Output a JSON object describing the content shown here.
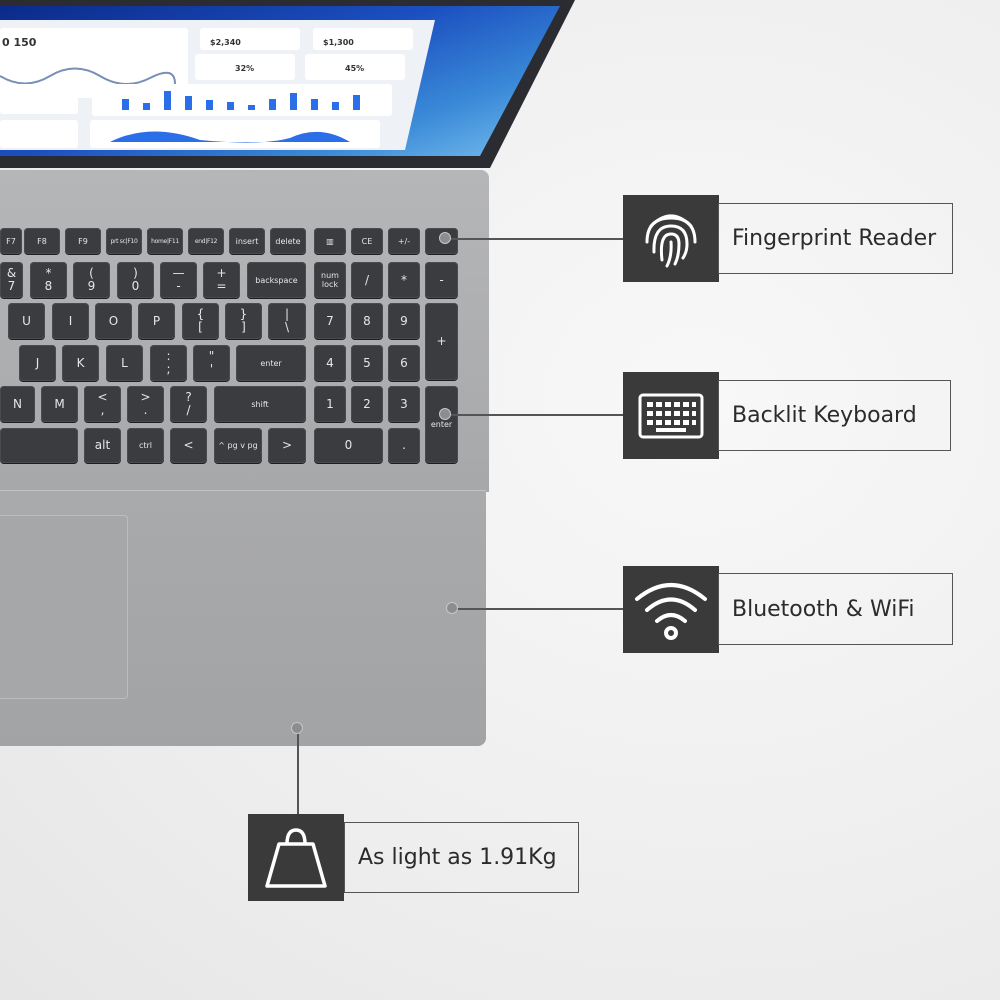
{
  "screen": {
    "stat_main": "0 150",
    "stat_1": "$2,340",
    "stat_2": "$1,300",
    "donut_1": "32%",
    "donut_2": "45%",
    "bar_chart_values": [
      50,
      30,
      85,
      62,
      45,
      35,
      25,
      52,
      78,
      50,
      38,
      68
    ]
  },
  "keyboard": {
    "rows": [
      [
        "F7",
        "F8",
        "F9",
        "prt sc|F10",
        "home|F11",
        "end|F12",
        "insert",
        "delete",
        "▥",
        "CE",
        "+/-",
        ""
      ],
      [
        "& 7",
        "* 8",
        "( 9",
        ") 0",
        "— -",
        "+ =",
        "backspace",
        "num lock",
        "/",
        "*",
        "-"
      ],
      [
        "U",
        "I",
        "O",
        "P",
        "{ [",
        "} ]",
        "| \\",
        "7",
        "8",
        "9",
        "+"
      ],
      [
        "J",
        "K",
        "L",
        ": ;",
        "\" '",
        "enter",
        "4",
        "5",
        "6"
      ],
      [
        "N",
        "M",
        "< ,",
        "> .",
        "? /",
        "shift",
        "1",
        "2",
        "3",
        "enter"
      ],
      [
        "",
        "alt",
        "ctrl",
        "<",
        "^ pg  v pg",
        ">",
        "0",
        "."
      ]
    ]
  },
  "callouts": [
    {
      "icon": "fingerprint-icon",
      "label": "Fingerprint Reader"
    },
    {
      "icon": "keyboard-icon",
      "label": "Backlit Keyboard"
    },
    {
      "icon": "wifi-icon",
      "label": "Bluetooth & WiFi"
    },
    {
      "icon": "shopping-bag-icon",
      "label": "As light as 1.91Kg"
    }
  ],
  "colors": {
    "icon_box": "#3a3a3a",
    "key": "#3b3c3f",
    "chassis": "#a9aaac"
  }
}
